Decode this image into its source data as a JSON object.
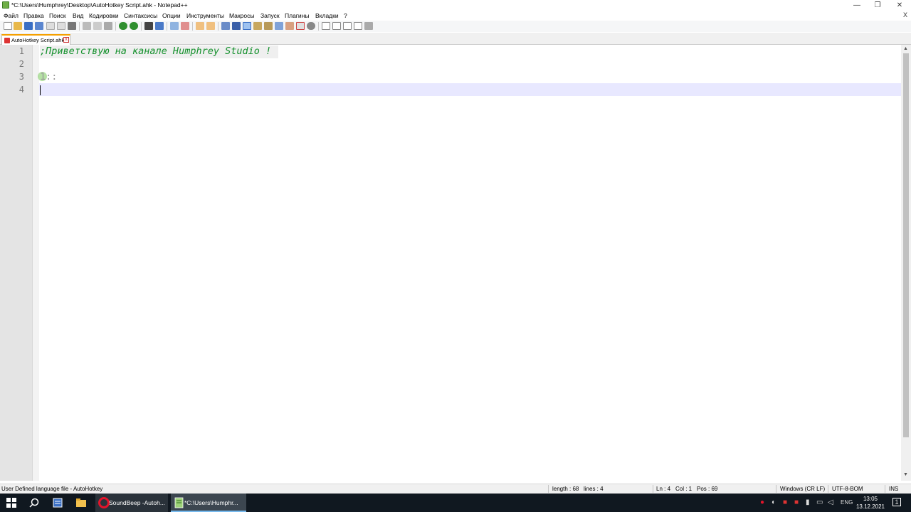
{
  "window": {
    "title": "*C:\\Users\\Humphrey\\Desktop\\AutoHotkey Script.ahk - Notepad++",
    "controls": {
      "minimize": "—",
      "maximize": "❐",
      "close": "✕"
    }
  },
  "menu": {
    "items": [
      "Файл",
      "Правка",
      "Поиск",
      "Вид",
      "Кодировки",
      "Синтаксисы",
      "Опции",
      "Инструменты",
      "Макросы",
      "Запуск",
      "Плагины",
      "Вкладки",
      "?"
    ],
    "close_doc": "X"
  },
  "toolbar": {
    "icons": [
      "new-file-icon",
      "open-file-icon",
      "save-icon",
      "save-all-icon",
      "close-icon",
      "close-all-icon",
      "print-icon",
      "cut-icon",
      "copy-icon",
      "paste-icon",
      "undo-icon",
      "redo-icon",
      "find-icon",
      "replace-icon",
      "zoom-in-icon",
      "zoom-out-icon",
      "sync-vertical-icon",
      "sync-horizontal-icon",
      "word-wrap-icon",
      "show-all-chars-icon",
      "indent-guide-icon",
      "doc-map-icon",
      "function-list-icon",
      "folder-workspace-icon",
      "doc-list-icon",
      "monitoring-icon",
      "record-macro-icon",
      "stop-record-icon",
      "play-macro-icon",
      "run-macro-multiple-icon",
      "save-macro-icon"
    ]
  },
  "tabs": [
    {
      "label": "AutoHotkey Script.ahk",
      "close": "x"
    }
  ],
  "editor": {
    "lines": [
      {
        "num": "1",
        "text": ";Приветствую на канале Humphrey Studio !"
      },
      {
        "num": "2",
        "text": ""
      },
      {
        "num": "3",
        "text": "1::"
      },
      {
        "num": "4",
        "text": ""
      }
    ]
  },
  "status": {
    "language": "User Defined language file - AutoHotkey",
    "length": "length : 68",
    "lines": "lines : 4",
    "ln": "Ln : 4",
    "col": "Col : 1",
    "pos": "Pos : 69",
    "eol": "Windows (CR LF)",
    "encoding": "UTF-8-BOM",
    "mode": "INS"
  },
  "taskbar": {
    "apps": [
      {
        "label": "SoundBeep -Autoh...",
        "icon": "opera-icon"
      },
      {
        "label": "*C:\\Users\\Humphr...",
        "icon": "notepadpp-icon"
      }
    ],
    "language": "ENG",
    "time": "13:05",
    "date": "13.12.2021",
    "notification_count": "1"
  },
  "colors": {
    "comment": "#15912d",
    "current_line": "#e8e8ff",
    "taskbar": "#101820",
    "tab_accent": "#f5a000"
  }
}
